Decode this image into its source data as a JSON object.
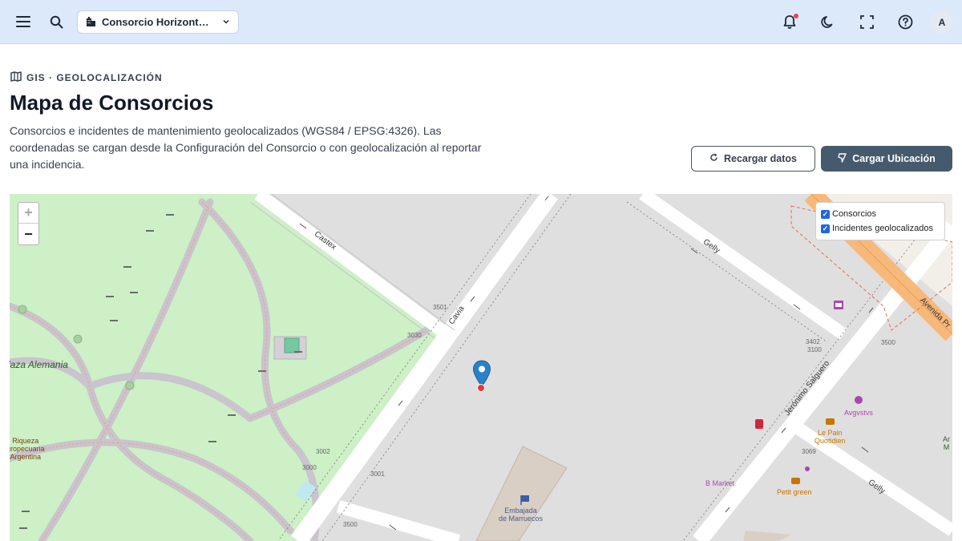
{
  "topbar": {
    "consortium_selector": "Consorcio Horizonte ...",
    "avatar_initial": "A"
  },
  "page": {
    "eyebrow": "GIS · GEOLOCALIZACIÓN",
    "title": "Mapa de Consorcios",
    "description": "Consorcios e incidentes de mantenimiento geolocalizados (WGS84 / EPSG:4326). Las coordenadas se cargan desde la Configuración del Consorcio o con geolocalización al reportar una incidencia.",
    "reload_button": "Recargar datos",
    "load_location_button": "Cargar Ubicación"
  },
  "map": {
    "zoom_in": "+",
    "zoom_out": "−",
    "layers": {
      "consortiums": "Consorcios",
      "incidents": "Incidentes geolocalizados"
    },
    "streets": {
      "castex": "Castex",
      "cavia": "Cavia",
      "gelly_top": "Gelly",
      "gelly_bottom": "Gelly",
      "jeronimo": "Jerónimo Salguero",
      "avenida": "Avenida Pr"
    },
    "places": {
      "plaza": "laza Alemania",
      "riqueza": "Riqueza\ngropecuaria\nArgentina",
      "embajada": "Embajada\nde Marruecos",
      "augustus": "Avgvstvs",
      "le_pain": "Le Pain\nQuotidien",
      "b_market": "B Market",
      "petit_green": "Petit green",
      "edge": "Ar\nM"
    },
    "house_numbers": {
      "n3501": "3501",
      "n3030": "3030",
      "n3002": "3002",
      "n3000": "3000",
      "n3001": "3001",
      "n3500a": "3500",
      "n3500b": "3500",
      "n3402": "3402",
      "n3100": "3100",
      "n3069": "3069"
    }
  },
  "colors": {
    "topbar_bg": "#dce9fb",
    "primary_button": "#465a6e",
    "park": "#cdf0c6",
    "marker": "#2a81cb",
    "incident_dot": "#e53935"
  }
}
